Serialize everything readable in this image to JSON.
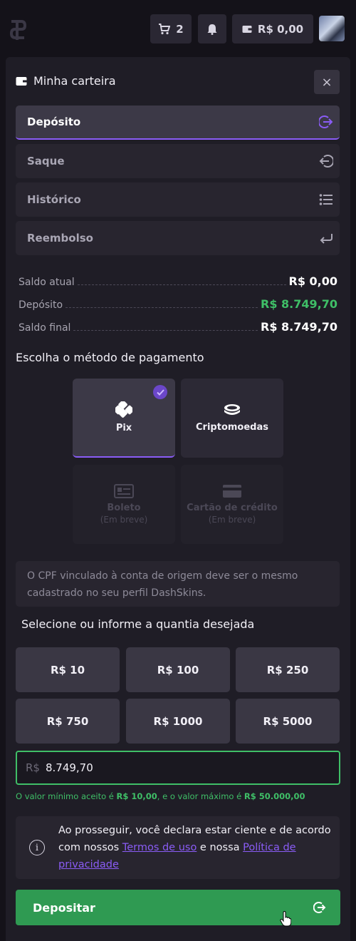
{
  "header": {
    "cart_count": "2",
    "balance": "R$ 0,00",
    "icons": [
      "logo",
      "cart-icon",
      "bell-icon",
      "wallet-icon",
      "avatar"
    ]
  },
  "wallet": {
    "title": "Minha carteira",
    "close": "×",
    "menu": [
      {
        "label": "Depósito",
        "icon": "deposit-icon",
        "active": true
      },
      {
        "label": "Saque",
        "icon": "withdraw-icon"
      },
      {
        "label": "Histórico",
        "icon": "history-icon"
      },
      {
        "label": "Reembolso",
        "icon": "refund-icon"
      }
    ],
    "summary": [
      {
        "label": "Saldo atual",
        "value": "R$ 0,00"
      },
      {
        "label": "Depósito",
        "value": "R$ 8.749,70"
      },
      {
        "label": "Saldo final",
        "value": "R$ 8.749,70"
      }
    ]
  },
  "payment": {
    "heading": "Escolha o método de pagamento",
    "methods": [
      {
        "label": "Pix",
        "selected": true
      },
      {
        "label": "Criptomoedas"
      },
      {
        "label": "Boleto",
        "sub": "(Em breve)",
        "disabled": true
      },
      {
        "label": "Cartão de crédito",
        "sub": "(Em breve)",
        "disabled": true
      }
    ],
    "notice": "O CPF vinculado à conta de origem deve ser o mesmo cadastrado no seu perfil DashSkins."
  },
  "amount": {
    "heading": "Selecione ou informe a quantia desejada",
    "presets": [
      "R$ 10",
      "R$ 100",
      "R$ 250",
      "R$ 750",
      "R$ 1000",
      "R$ 5000"
    ],
    "prefix": "R$",
    "value": "8.749,70",
    "limits": {
      "text1": "O valor mínimo aceito é ",
      "min": "R$ 10,00",
      "text2": ", e o valor máximo é ",
      "max": "R$ 50.000,00"
    }
  },
  "terms": {
    "text1": "Ao prosseguir, você declara estar ciente e de acordo com nossos ",
    "link1": "Termos de uso",
    "text2": " e nossa ",
    "link2": "Política de privacidade"
  },
  "cta": {
    "label": "Depositar"
  },
  "colors": {
    "accent": "#8a5cf6",
    "success": "#3fbf67",
    "button": "#2f9a52",
    "panel": "#1f1d26"
  }
}
